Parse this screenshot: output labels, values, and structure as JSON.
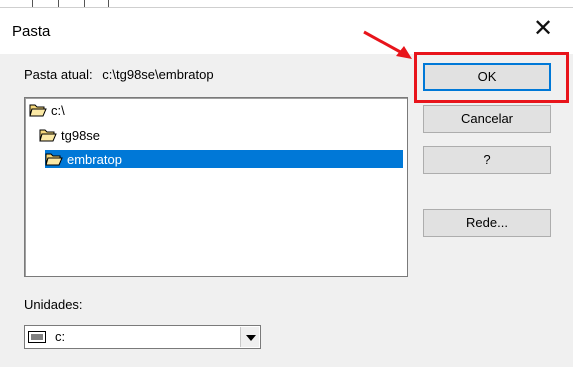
{
  "window": {
    "title": "Pasta",
    "close_symbol": "✕"
  },
  "current_folder": {
    "label": "Pasta atual:",
    "path": "c:\\tg98se\\embratop"
  },
  "folder_tree": {
    "items": [
      {
        "label": "c:\\",
        "icon": "open-folder-icon",
        "selected": false
      },
      {
        "label": "tg98se",
        "icon": "open-folder-icon",
        "selected": false
      },
      {
        "label": "embratop",
        "icon": "open-folder-icon",
        "selected": true
      }
    ]
  },
  "buttons": {
    "ok": "OK",
    "cancel": "Cancelar",
    "help": "?",
    "network": "Rede..."
  },
  "drives": {
    "label": "Unidades:",
    "selected": "c:",
    "icon": "drive-icon"
  },
  "colors": {
    "selection": "#0078d7",
    "annotation": "#e8141b"
  }
}
